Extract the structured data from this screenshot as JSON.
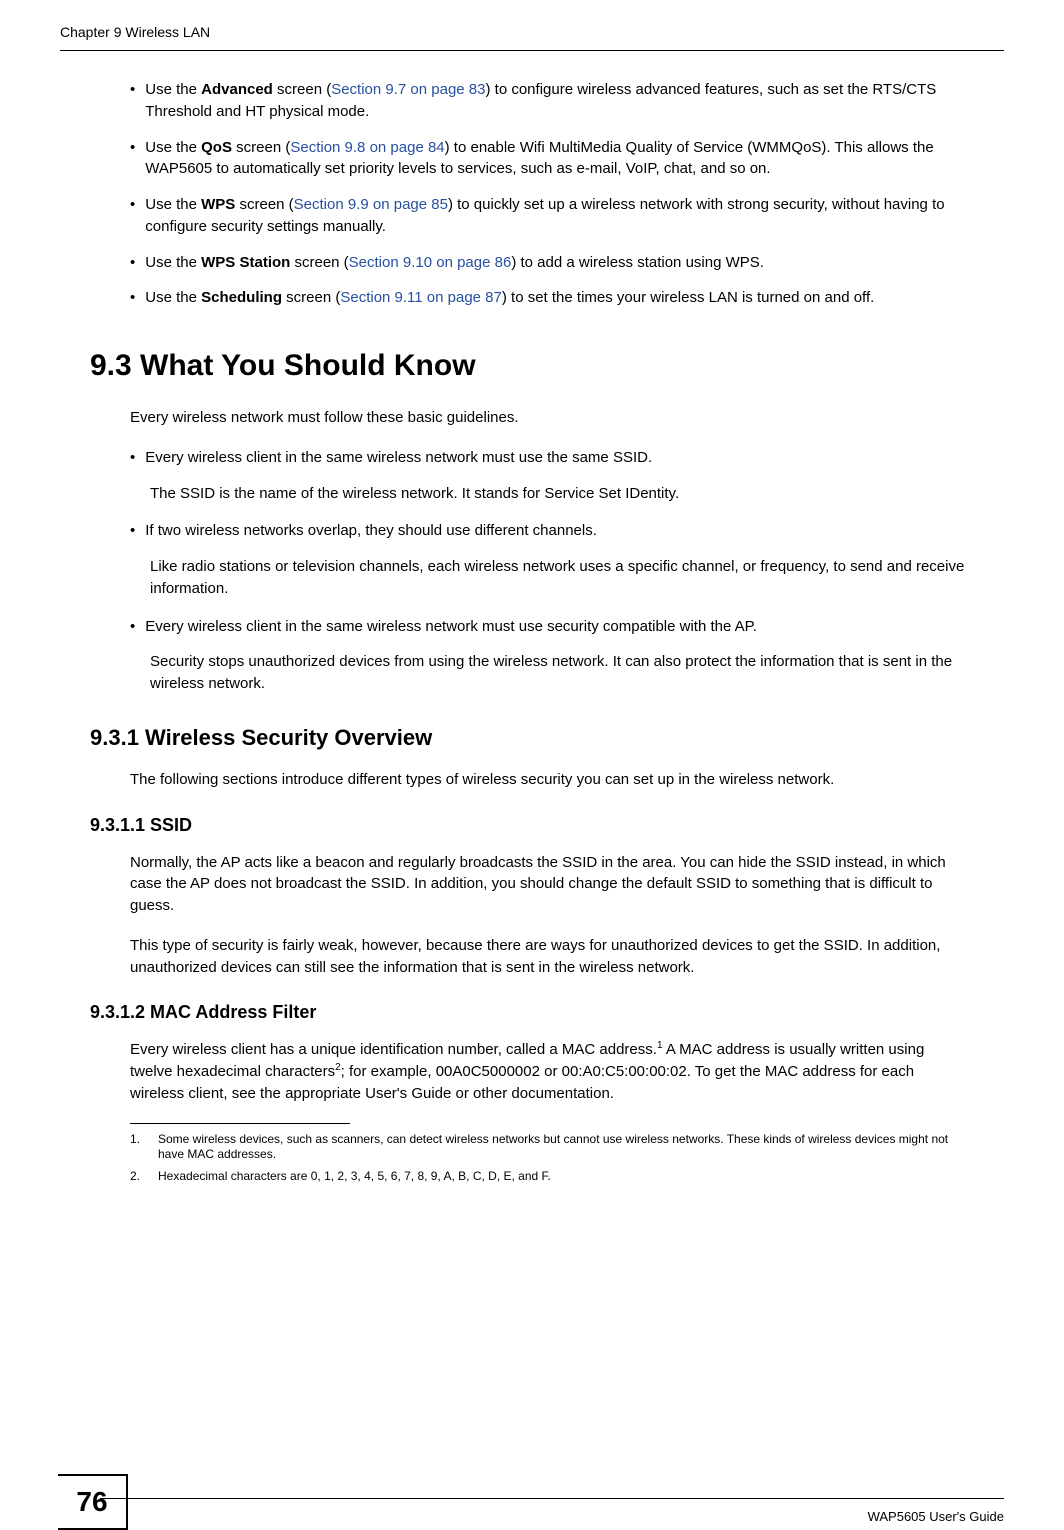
{
  "header": {
    "chapter": "Chapter 9 Wireless LAN"
  },
  "bullets": [
    {
      "prefix": "Use the ",
      "bold": "Advanced",
      "mid1": " screen (",
      "link": "Section 9.7 on page 83",
      "rest": ") to configure wireless advanced features, such as set the  RTS/CTS Threshold and HT physical mode."
    },
    {
      "prefix": "Use the ",
      "bold": "QoS",
      "mid1": " screen (",
      "link": "Section 9.8 on page 84",
      "rest": ") to enable Wifi MultiMedia Quality of Service (WMMQoS). This allows the WAP5605 to automatically set priority levels to services, such as e-mail, VoIP, chat, and so on."
    },
    {
      "prefix": "Use the ",
      "bold": "WPS",
      "mid1": " screen (",
      "link": "Section 9.9 on page 85",
      "rest": ") to quickly set up a wireless network with strong security, without having to configure security settings manually."
    },
    {
      "prefix": "Use the ",
      "bold": "WPS Station",
      "mid1": " screen (",
      "link": "Section 9.10 on page 86",
      "rest": ") to add a wireless station using WPS."
    },
    {
      "prefix": "Use the ",
      "bold": "Scheduling",
      "mid1": " screen (",
      "link": "Section 9.11 on page 87",
      "rest": ") to set the times your wireless LAN is turned on and off."
    }
  ],
  "section93": {
    "title": "9.3  What You Should Know",
    "intro": "Every wireless network must follow these basic guidelines.",
    "guidelines": [
      {
        "main": "Every wireless client in the same wireless network must use the same SSID.",
        "sub": "The SSID is the name of the wireless network. It stands for Service Set IDentity."
      },
      {
        "main": "If two wireless networks overlap, they should use different channels.",
        "sub": "Like radio stations or television channels, each wireless network uses a specific channel, or frequency, to send and receive information."
      },
      {
        "main": "Every wireless client in the same wireless network must use security compatible with the AP.",
        "sub": "Security stops unauthorized devices from using the wireless network. It can also protect the information that is sent in the wireless network."
      }
    ]
  },
  "section931": {
    "title": "9.3.1  Wireless Security Overview",
    "para": "The following sections introduce different types of wireless security you can set up in the wireless network."
  },
  "section9311": {
    "title": "9.3.1.1  SSID",
    "p1": "Normally, the AP acts like a beacon and regularly broadcasts the SSID in the area. You can hide the SSID instead, in which case the AP does not broadcast the SSID. In addition, you should change the default SSID to something that is difficult to guess.",
    "p2": "This type of security is fairly weak, however, because there are ways for unauthorized devices to get the SSID. In addition, unauthorized devices can still see the information that is sent in the wireless network."
  },
  "section9312": {
    "title": "9.3.1.2  MAC Address Filter",
    "p1a": "Every wireless client has a unique identification number, called a MAC address.",
    "sup1": "1",
    "p1b": " A MAC address is usually written using twelve hexadecimal characters",
    "sup2": "2",
    "p1c": "; for example, 00A0C5000002 or 00:A0:C5:00:00:02. To get the MAC address for each wireless client, see the appropriate User's Guide or other documentation."
  },
  "footnotes": [
    {
      "num": "1.",
      "text": "Some wireless devices, such as scanners, can detect wireless networks but cannot use wireless networks. These kinds of wireless devices might not have MAC addresses."
    },
    {
      "num": "2.",
      "text": "Hexadecimal characters are 0, 1, 2, 3, 4, 5, 6, 7, 8, 9, A, B, C, D, E, and F."
    }
  ],
  "footer": {
    "page": "76",
    "guide": "WAP5605 User's Guide"
  }
}
